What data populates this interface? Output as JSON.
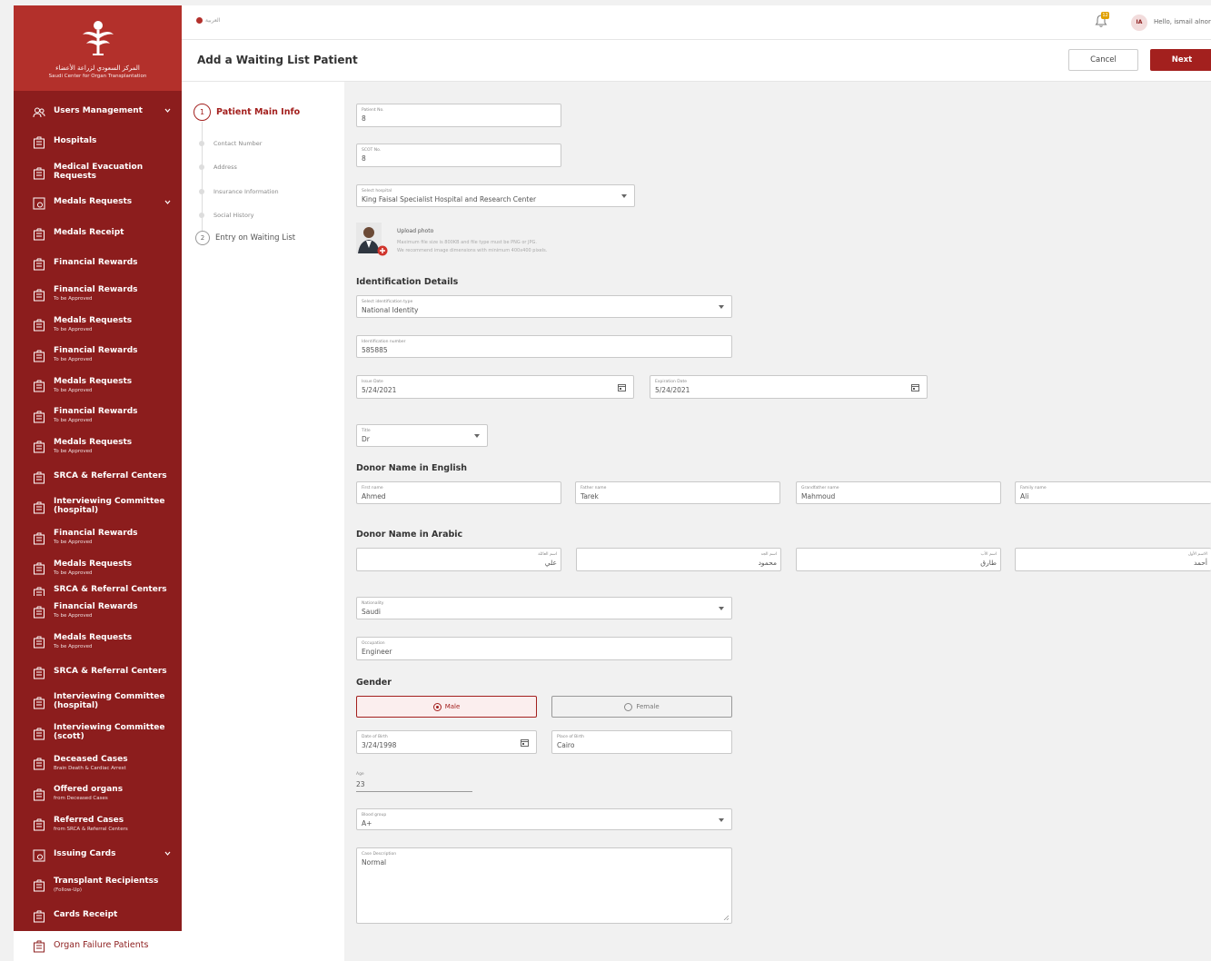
{
  "brand": {
    "name_ar": "المركز السعودي لزراعة الأعضاء",
    "name_en": "Saudi Center for Organ Transplantation",
    "primary_color": "#8c1d1d",
    "accent_color": "#a3201e"
  },
  "sidebar": {
    "items": [
      {
        "title": "Users Management",
        "sub": "",
        "icon": "users-icon",
        "chevron": true
      },
      {
        "title": "Hospitals",
        "sub": "",
        "icon": "building-icon"
      },
      {
        "title": "Medical Evacuation Requests",
        "sub": "",
        "icon": "building-icon"
      },
      {
        "title": "Medals Requests",
        "sub": "",
        "icon": "medal-icon",
        "chevron": true
      },
      {
        "title": "Medals Receipt",
        "sub": "",
        "icon": "building-icon"
      },
      {
        "title": "Financial Rewards",
        "sub": "",
        "icon": "building-icon"
      },
      {
        "title": "Financial Rewards",
        "sub": "To be Approved",
        "icon": "building-icon"
      },
      {
        "title": "Medals Requests",
        "sub": "To be Approved",
        "icon": "building-icon"
      },
      {
        "title": "Financial Rewards",
        "sub": "To be Approved",
        "icon": "building-icon"
      },
      {
        "title": "Medals Requests",
        "sub": "To be Approved",
        "icon": "building-icon"
      },
      {
        "title": "Financial Rewards",
        "sub": "To be Approved",
        "icon": "building-icon"
      },
      {
        "title": "Medals Requests",
        "sub": "To be Approved",
        "icon": "building-icon"
      },
      {
        "title": "SRCA & Referral Centers",
        "sub": "",
        "icon": "building-icon"
      },
      {
        "title": "Interviewing Committee (hospital)",
        "sub": "",
        "icon": "building-icon"
      },
      {
        "title": "Financial Rewards",
        "sub": "To be Approved",
        "icon": "building-icon"
      },
      {
        "title": "Medals Requests",
        "sub": "To be Approved",
        "icon": "building-icon"
      },
      {
        "title": "SRCA & Referral Centers",
        "sub": "",
        "icon": "building-icon",
        "clipped": true
      },
      {
        "title": "Financial Rewards",
        "sub": "To be Approved",
        "icon": "building-icon"
      },
      {
        "title": "Medals Requests",
        "sub": "To be Approved",
        "icon": "building-icon"
      },
      {
        "title": "SRCA & Referral Centers",
        "sub": "",
        "icon": "building-icon"
      },
      {
        "title": "Interviewing Committee (hospital)",
        "sub": "",
        "icon": "building-icon"
      },
      {
        "title": "Interviewing Committee (scott)",
        "sub": "",
        "icon": "building-icon"
      },
      {
        "title": "Deceased Cases",
        "sub": "Brain Death & Cardiac Arrest",
        "icon": "building-icon"
      },
      {
        "title": "Offered organs",
        "sub": "from Deceased Cases",
        "icon": "building-icon"
      },
      {
        "title": "Referred Cases",
        "sub": "from SRCA & Referral Centers",
        "icon": "building-icon"
      },
      {
        "title": "Issuing Cards",
        "sub": "",
        "icon": "medal-icon",
        "chevron": true
      },
      {
        "title": "Transplant Recipientss",
        "sub": "(Follow-Up)",
        "icon": "building-icon"
      },
      {
        "title": "Cards Receipt",
        "sub": "",
        "icon": "building-icon"
      },
      {
        "title": "Organ Failure Patients",
        "sub": "",
        "icon": "building-icon",
        "active": true
      }
    ]
  },
  "topbar": {
    "language": "العربية",
    "notification_count": "12",
    "avatar_initials": "IA",
    "greeting": "Hello, ismail alnor"
  },
  "header": {
    "title": "Add a Waiting List Patient",
    "cancel_label": "Cancel",
    "next_label": "Next"
  },
  "stepper": {
    "steps": [
      {
        "num": "1",
        "label": "Patient Main Info"
      },
      {
        "num": "2",
        "label": "Entry on Waiting List"
      }
    ],
    "substeps": [
      "Contact Number",
      "Address",
      "Insurance Information",
      "Social History"
    ]
  },
  "form": {
    "patient_no": {
      "label": "Patient No.",
      "value": "8"
    },
    "scot_no": {
      "label": "SCOT No.",
      "value": "8"
    },
    "hospital": {
      "label": "Select hospital",
      "value": "King Faisal Specialist Hospital and Research Center"
    },
    "upload": {
      "title": "Upload photo",
      "hint1": "Maximum file size is 800KB and file type must be PNG or JPG.",
      "hint2": "We recommend image dimensions with minimum 400x400 pixels."
    },
    "identification_title": "Identification Details",
    "id_type": {
      "label": "Select identification type",
      "value": "National Identity"
    },
    "id_number": {
      "label": "Identification number",
      "value": "585885"
    },
    "issue_date": {
      "label": "Issue Date",
      "value": "5/24/2021"
    },
    "expiration_date": {
      "label": "Expiration Date",
      "value": "5/24/2021"
    },
    "title": {
      "label": "Title",
      "value": "Dr"
    },
    "name_en_title": "Donor Name in English",
    "first_name": {
      "label": "First name",
      "value": "Ahmed"
    },
    "father_name": {
      "label": "Father name",
      "value": "Tarek"
    },
    "grandfather_name": {
      "label": "Grandfather name",
      "value": "Mahmoud"
    },
    "family_name": {
      "label": "Family name",
      "value": "Ali"
    },
    "name_ar_title": "Donor Name in Arabic",
    "family_name_ar": {
      "label": "اسم العائلة",
      "value": "علي"
    },
    "grandfather_name_ar": {
      "label": "اسم الجد",
      "value": "محمود"
    },
    "father_name_ar": {
      "label": "اسم الأب",
      "value": "طارق"
    },
    "first_name_ar": {
      "label": "الاسم الأول",
      "value": "أحمد"
    },
    "nationality": {
      "label": "Nationality",
      "value": "Saudi"
    },
    "occupation": {
      "label": "Occupation",
      "value": "Engineer"
    },
    "gender_title": "Gender",
    "gender_male": "Male",
    "gender_female": "Female",
    "gender_selected": "Male",
    "date_of_birth": {
      "label": "Date of Birth",
      "value": "3/24/1998"
    },
    "place_of_birth": {
      "label": "Place of Birth",
      "value": "Cairo"
    },
    "age": {
      "label": "Age",
      "value": "23"
    },
    "blood_group": {
      "label": "Blood group",
      "value": "A+"
    },
    "case_description": {
      "label": "Case Description",
      "value": "Normal"
    }
  }
}
